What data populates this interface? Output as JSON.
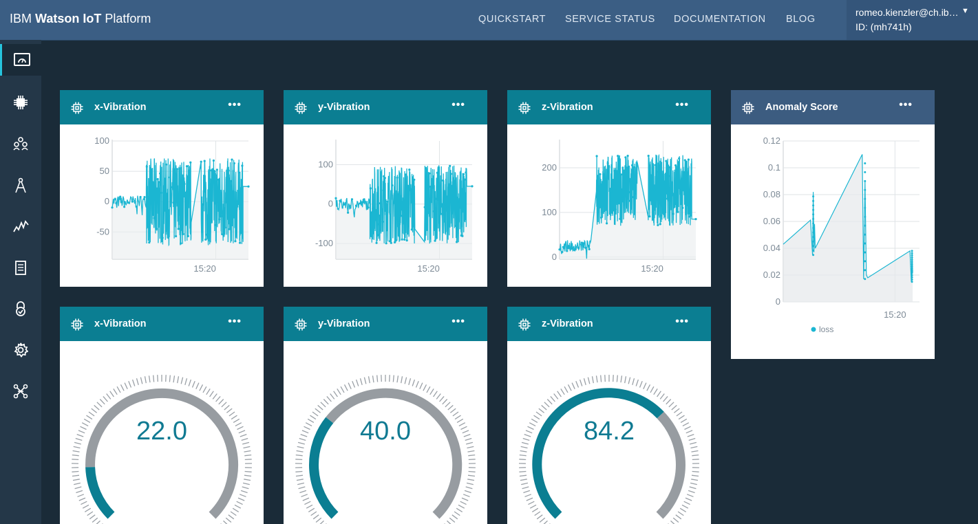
{
  "header": {
    "brand_prefix": "IBM ",
    "brand_bold": "Watson IoT",
    "brand_suffix": " Platform",
    "nav": [
      "QUICKSTART",
      "SERVICE STATUS",
      "DOCUMENTATION",
      "BLOG"
    ],
    "user_email": "romeo.kienzler@ch.ib…",
    "user_id": "ID: (mh741h)",
    "user_caret": "▼"
  },
  "sidebar": {
    "icons": [
      "dashboard-icon",
      "devices-chip-icon",
      "members-icon",
      "apps-icon",
      "analytics-icon",
      "reports-icon",
      "security-lock-icon",
      "settings-gear-icon",
      "extensions-icon"
    ],
    "active_index": 0
  },
  "colors": {
    "accent": "#0b7e92",
    "line": "#1bb6d2",
    "gauge_gray": "#979ca1",
    "topbar": "#3b5e84"
  },
  "cards": {
    "x_chart": {
      "title": "x-Vibration",
      "menu": "•••"
    },
    "y_chart": {
      "title": "y-Vibration",
      "menu": "•••"
    },
    "z_chart": {
      "title": "z-Vibration",
      "menu": "•••"
    },
    "anomaly": {
      "title": "Anomaly Score",
      "menu": "•••"
    },
    "x_gauge": {
      "title": "x-Vibration",
      "menu": "•••",
      "value": "22.0",
      "fraction": 0.16
    },
    "y_gauge": {
      "title": "y-Vibration",
      "menu": "•••",
      "value": "40.0",
      "fraction": 0.31
    },
    "z_gauge": {
      "title": "z-Vibration",
      "menu": "•••",
      "value": "84.2",
      "fraction": 0.67
    }
  },
  "chart_data": [
    {
      "id": "x",
      "type": "line",
      "title": "x-Vibration",
      "yticks": [
        100,
        50,
        0,
        -50
      ],
      "ylim": [
        -95,
        100
      ],
      "xtick": "15:20",
      "segments": [
        {
          "kind": "quiet",
          "start": 0.0,
          "end": 0.25,
          "center": 0,
          "amp": 14
        },
        {
          "kind": "burst",
          "start": 0.25,
          "end": 0.58,
          "center": 0,
          "amp": 72
        },
        {
          "kind": "burst",
          "start": 0.65,
          "end": 0.96,
          "center": 0,
          "amp": 72
        },
        {
          "kind": "flat",
          "start": 0.96,
          "end": 1.0,
          "value": 25
        }
      ]
    },
    {
      "id": "y",
      "type": "line",
      "title": "y-Vibration",
      "yticks": [
        100,
        0,
        -100
      ],
      "ylim": [
        -140,
        160
      ],
      "xtick": "15:20",
      "segments": [
        {
          "kind": "quiet",
          "start": 0.0,
          "end": 0.25,
          "center": 0,
          "amp": 22
        },
        {
          "kind": "burst",
          "start": 0.25,
          "end": 0.58,
          "center": 0,
          "amp": 100
        },
        {
          "kind": "burst",
          "start": 0.65,
          "end": 0.96,
          "center": 0,
          "amp": 100
        },
        {
          "kind": "flat",
          "start": 0.96,
          "end": 1.0,
          "value": 45
        }
      ]
    },
    {
      "id": "z",
      "type": "line",
      "title": "z-Vibration",
      "yticks": [
        200,
        100,
        0
      ],
      "ylim": [
        -5,
        260
      ],
      "xtick": "15:20",
      "segments": [
        {
          "kind": "quiet",
          "start": 0.0,
          "end": 0.23,
          "center": 25,
          "amp": 18
        },
        {
          "kind": "burst",
          "start": 0.27,
          "end": 0.57,
          "center": 150,
          "amp": 80
        },
        {
          "kind": "burst",
          "start": 0.65,
          "end": 0.97,
          "center": 150,
          "amp": 80
        },
        {
          "kind": "flat",
          "start": 0.97,
          "end": 1.0,
          "value": 85
        }
      ]
    },
    {
      "id": "anomaly",
      "type": "line",
      "title": "Anomaly Score",
      "yticks": [
        0.12,
        0.1,
        0.08,
        0.06,
        0.04,
        0.02,
        0
      ],
      "ylim": [
        0,
        0.12
      ],
      "xtick": "15:20",
      "legend": "loss",
      "x": [
        0,
        0.2,
        0.215,
        0.22,
        0.225,
        0.23,
        0.235,
        0.58,
        0.59,
        0.6,
        0.61,
        0.62,
        0.93,
        0.94,
        0.945,
        0.95
      ],
      "y": [
        0.043,
        0.061,
        0.035,
        0.082,
        0.037,
        0.058,
        0.04,
        0.11,
        0.017,
        0.09,
        0.02,
        0.018,
        0.038,
        0.015,
        0.036,
        0.022
      ]
    }
  ]
}
